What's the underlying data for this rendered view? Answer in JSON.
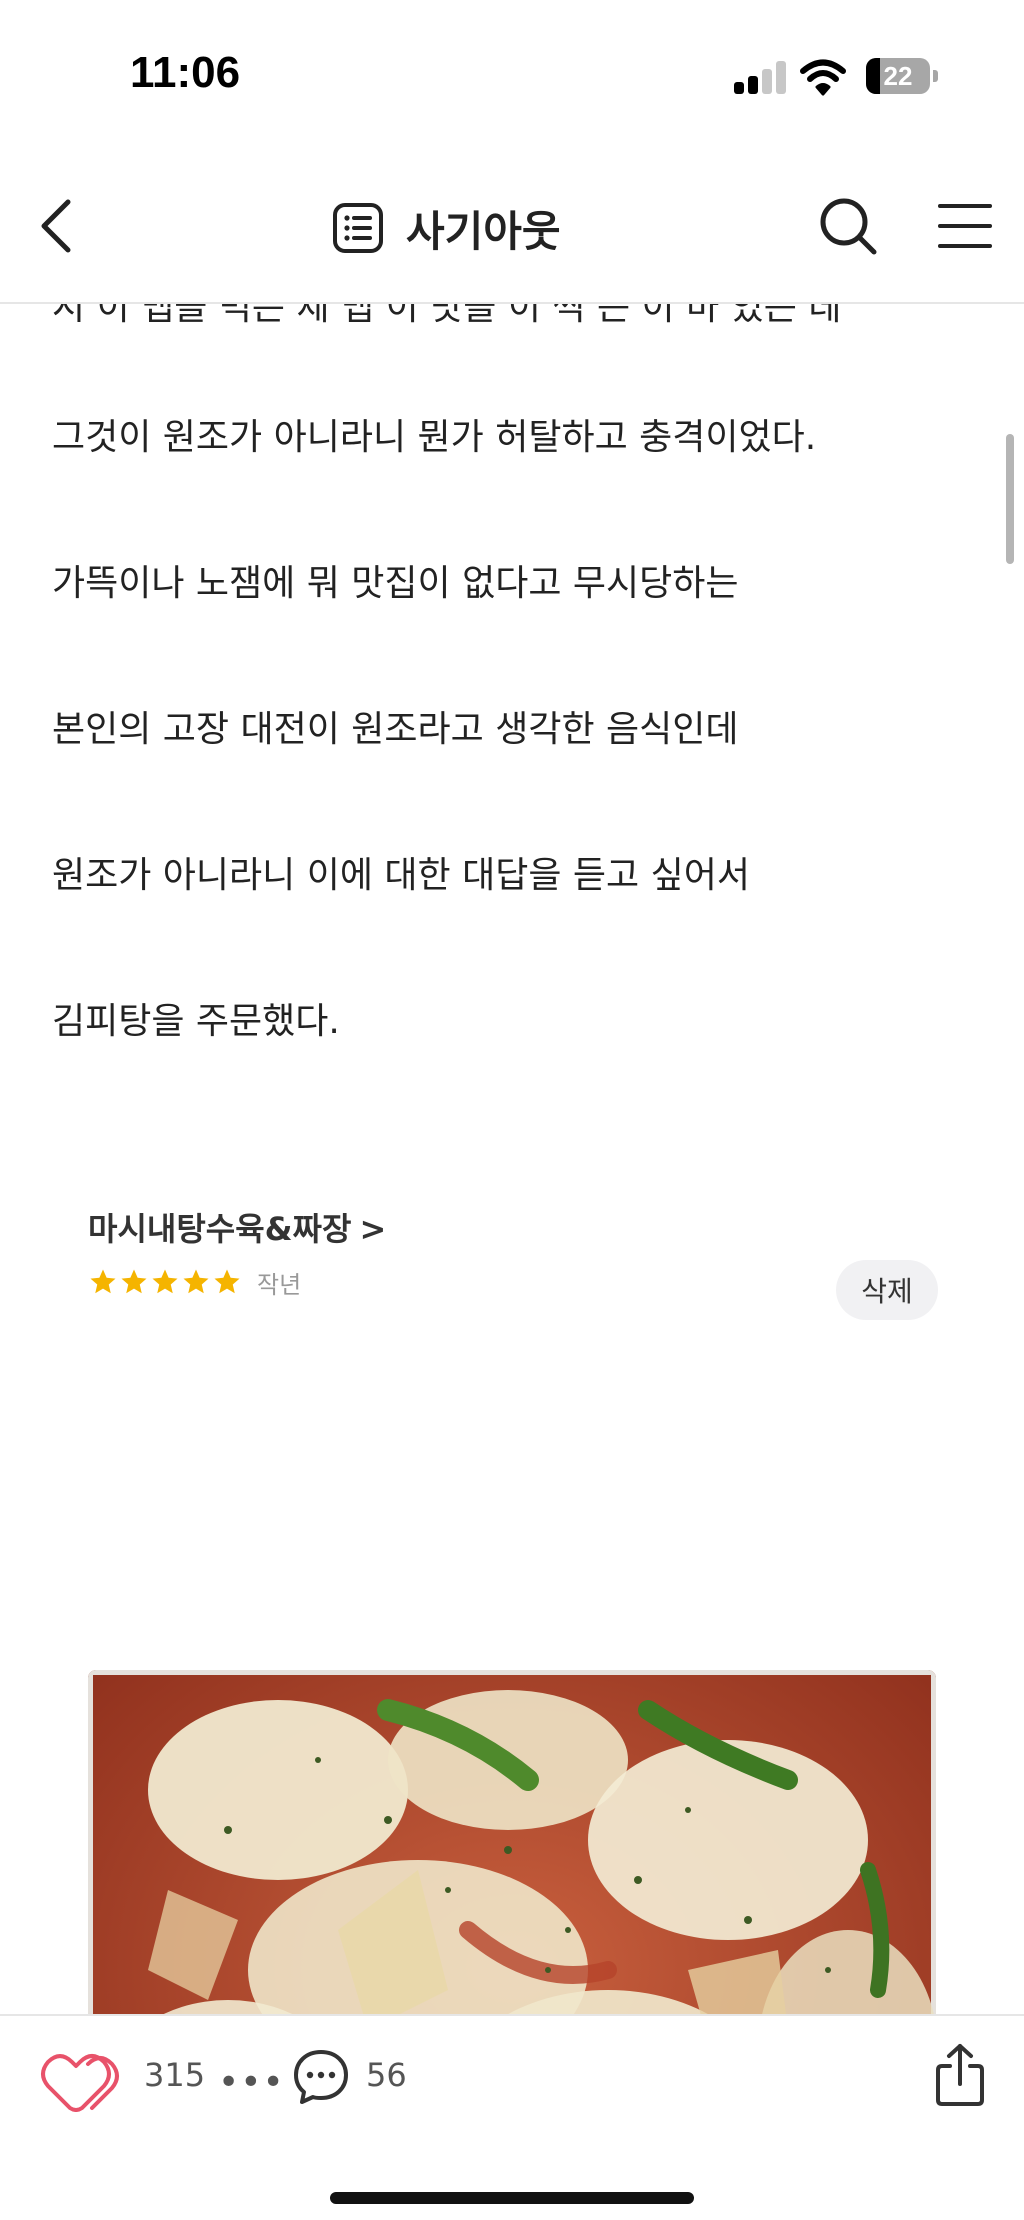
{
  "status_bar": {
    "time": "11:06",
    "battery": "22",
    "battery_level": 0.22
  },
  "nav": {
    "title": "사기아웃",
    "back_icon": "chevron-left-icon",
    "title_icon": "list-document-icon",
    "search_icon": "search-icon",
    "menu_icon": "hamburger-menu-icon"
  },
  "article": {
    "partial_line": "시 이 맵을 먹은 제 맵 이 맛을 이 씩 는 이 마 있는 데",
    "paragraphs": [
      "그것이 원조가 아니라니 뭔가 허탈하고 충격이었다.",
      "가뜩이나 노잼에 뭐 맛집이 없다고 무시당하는",
      "본인의 고장 대전이 원조라고 생각한 음식인데",
      "원조가 아니라니 이에 대한 대답을 듣고 싶어서",
      "김피탕을 주문했다."
    ]
  },
  "review_card": {
    "store_name": "마시내탕수육&짜장",
    "store_arrow": ">",
    "rating": 5,
    "star_color": "#f5b400",
    "date": "작년",
    "delete_label": "삭제"
  },
  "bottom_bar": {
    "like_count": "315",
    "more": "•••",
    "comment_count": "56",
    "like_icon": "heart-outline-icon",
    "comment_icon": "speech-bubble-icon",
    "share_icon": "share-icon",
    "like_color": "#e8526a"
  }
}
